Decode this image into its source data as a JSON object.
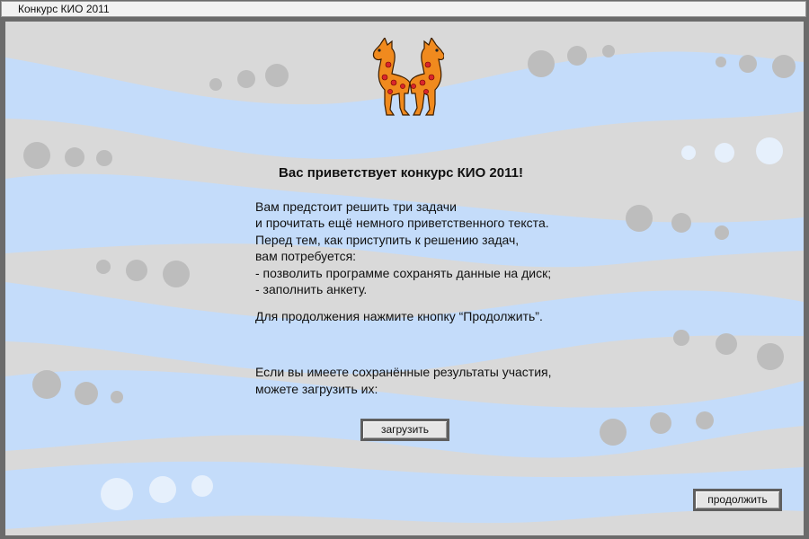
{
  "window": {
    "title": "Конкурс КИО 2011"
  },
  "welcome": {
    "heading": "Вас приветствует конкурс КИО 2011!",
    "lines": [
      "Вам предстоит решить три задачи",
      "и прочитать ещё немного приветственного текста.",
      "Перед тем, как приступить к решению задач,",
      "вам потребуется:",
      "- позволить программе сохранять данные на диск;",
      "- заполнить анкету."
    ],
    "continue_hint": "Для продолжения нажмите кнопку “Продолжить”.",
    "load_lines": [
      "Если вы имеете сохранённые результаты участия,",
      "можете загрузить их:"
    ]
  },
  "buttons": {
    "load": "загрузить",
    "continue": "продолжить"
  },
  "colors": {
    "blue_band": "#c4dcfa",
    "gray_band": "#d9d9d9",
    "gray_dot": "#bdbdbd",
    "horse_orange": "#f08a1e",
    "horse_spot": "#d9262b"
  },
  "icons": {
    "logo": "two-horses-logo-icon"
  }
}
